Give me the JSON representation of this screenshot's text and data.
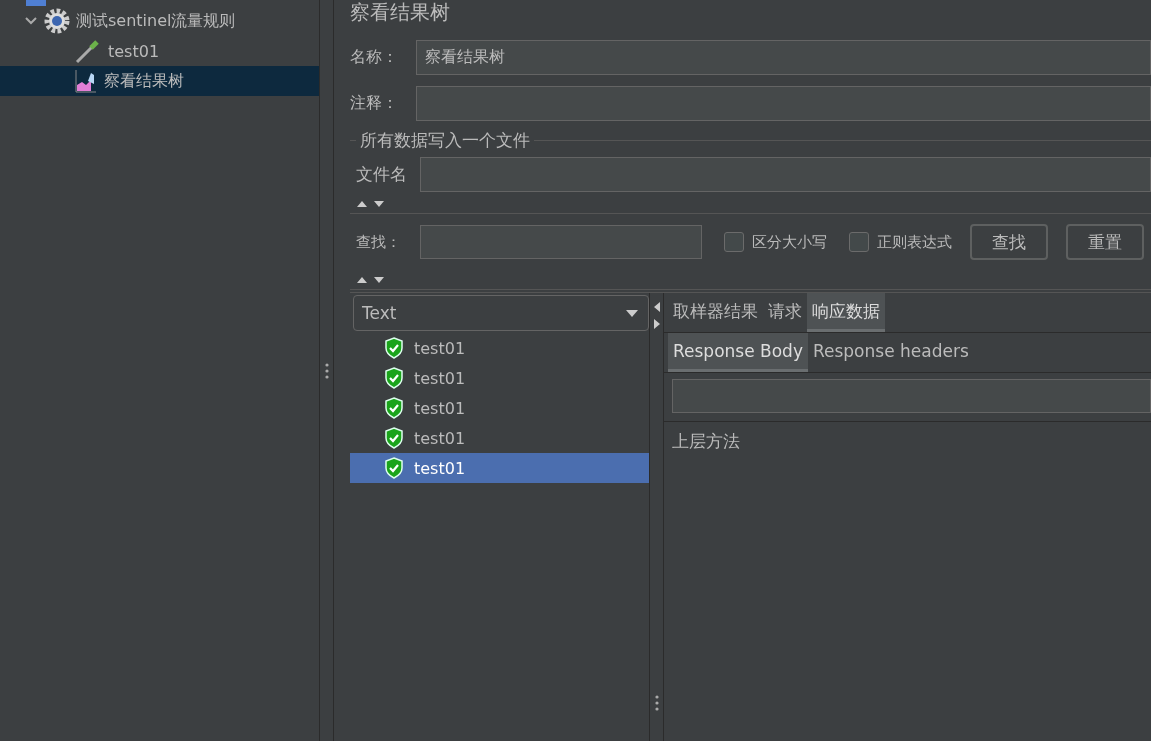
{
  "tree": {
    "items": [
      {
        "label": "测试sentinel流量规则",
        "kind": "gear",
        "expanded": true,
        "selected": false,
        "children": [
          {
            "label": "test01",
            "kind": "sampler",
            "selected": false
          },
          {
            "label": "察看结果树",
            "kind": "listener",
            "selected": true
          }
        ]
      }
    ]
  },
  "panel": {
    "title": "察看结果树",
    "name": {
      "label": "名称：",
      "value": "察看结果树"
    },
    "comment": {
      "label": "注释："
    },
    "file_group": {
      "legend": "所有数据写入一个文件",
      "label": "文件名"
    },
    "search": {
      "label": "查找：",
      "options": [
        {
          "label": "区分大小写",
          "checked": false
        },
        {
          "label": "正则表达式",
          "checked": false
        }
      ],
      "buttons": [
        "查找",
        "重置"
      ]
    },
    "renderer": {
      "value": "Text"
    },
    "results": [
      {
        "label": "test01",
        "selected": false
      },
      {
        "label": "test01",
        "selected": false
      },
      {
        "label": "test01",
        "selected": false
      },
      {
        "label": "test01",
        "selected": false
      },
      {
        "label": "test01",
        "selected": true
      }
    ],
    "tabs": [
      {
        "label": "取样器结果",
        "selected": false
      },
      {
        "label": "请求",
        "selected": false
      },
      {
        "label": "响应数据",
        "selected": true
      }
    ],
    "subtabs": [
      {
        "label": "Response Body",
        "selected": true
      },
      {
        "label": "Response headers",
        "selected": false
      }
    ],
    "body": "上层方法"
  }
}
